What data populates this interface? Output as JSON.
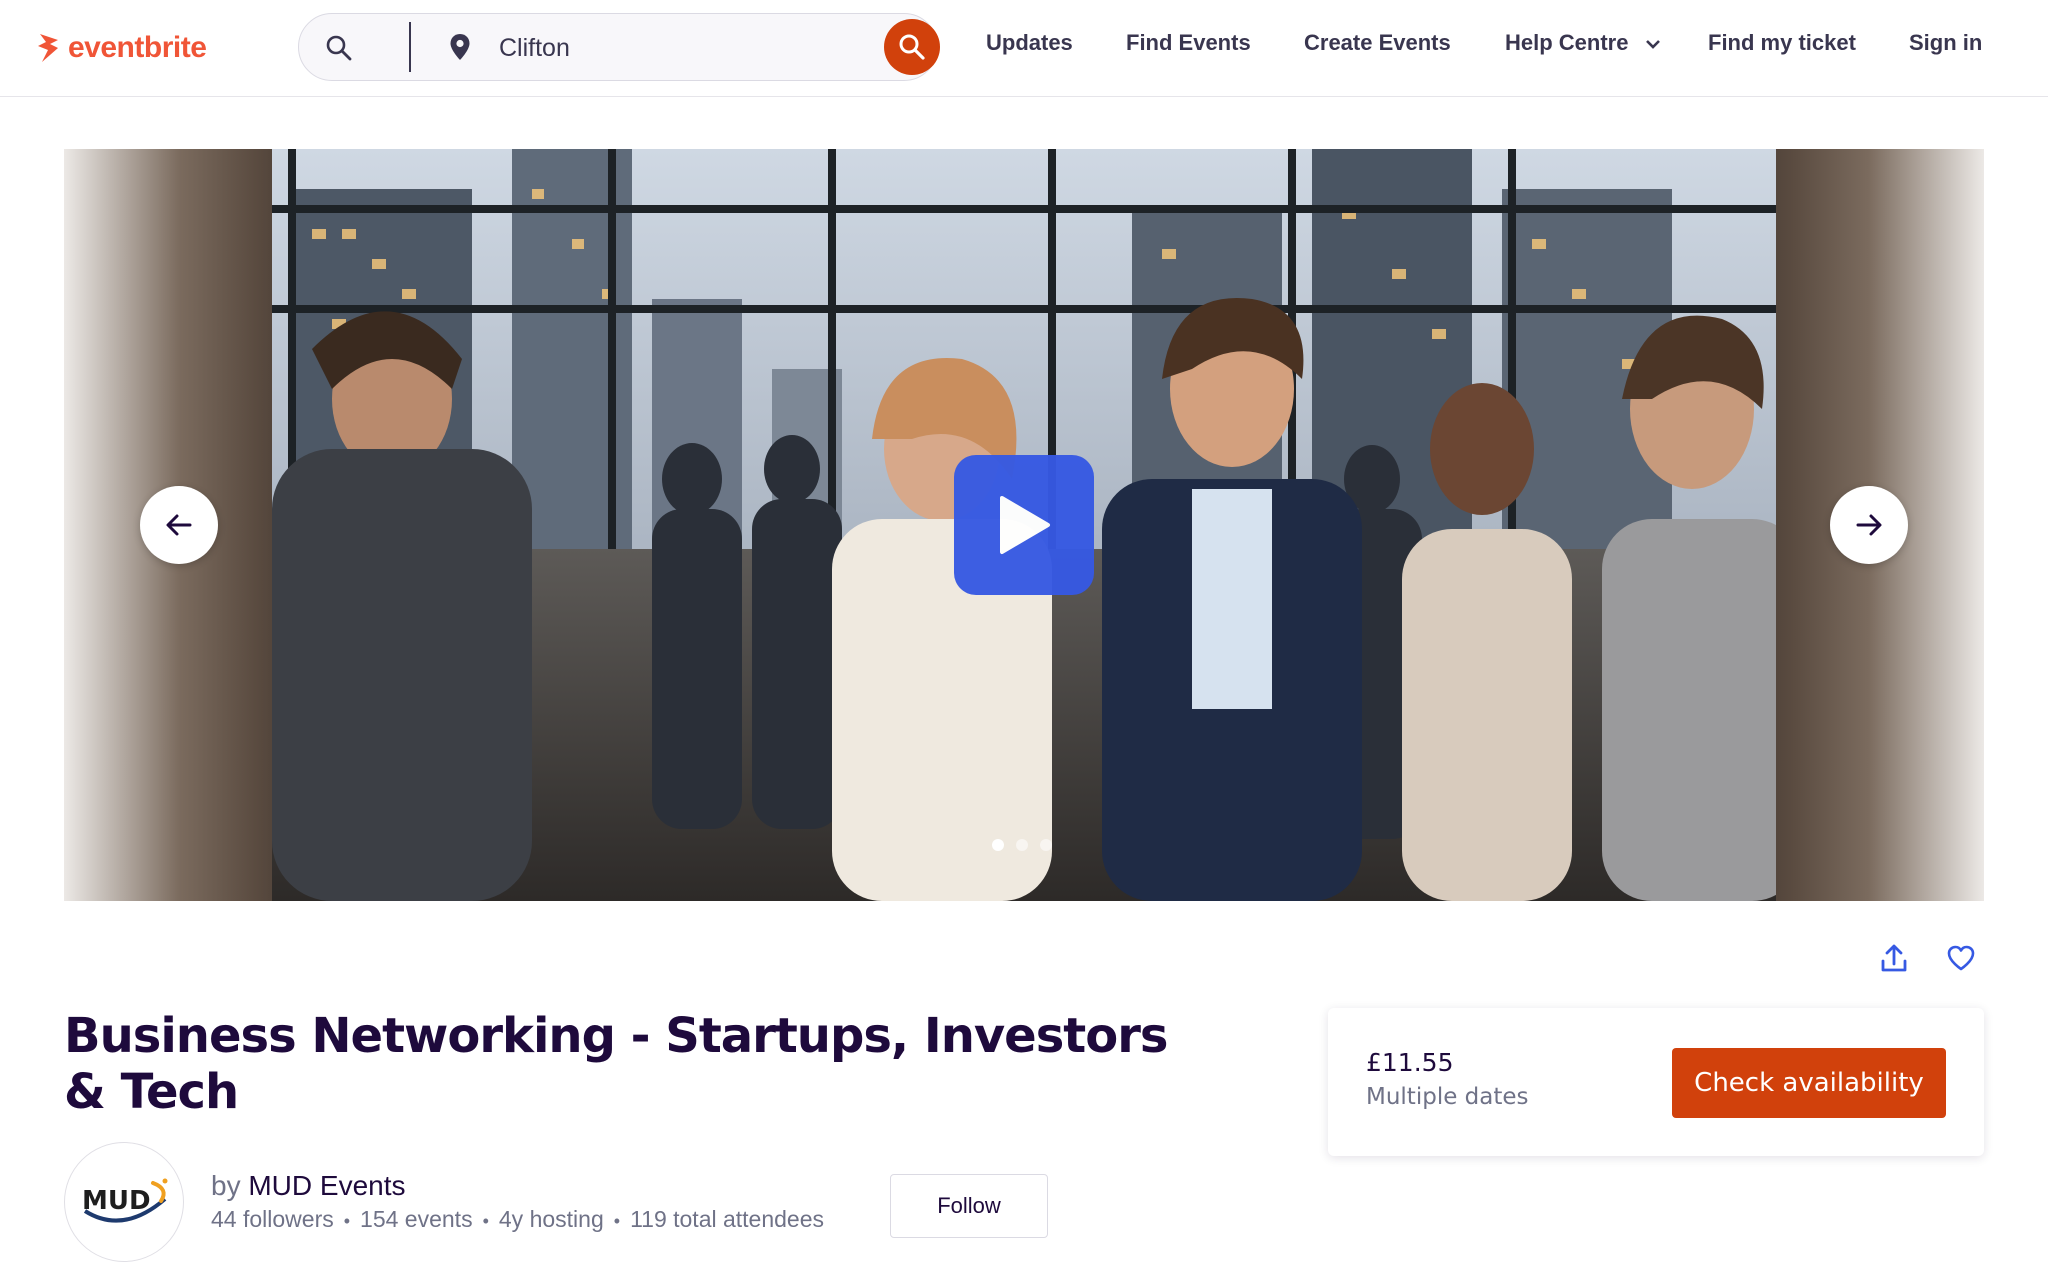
{
  "header": {
    "logo_text": "eventbrite",
    "search": {
      "location_value": "Clifton"
    },
    "nav": [
      {
        "label": "Updates"
      },
      {
        "label": "Find Events"
      },
      {
        "label": "Create Events"
      },
      {
        "label": "Help Centre"
      },
      {
        "label": "Find my ticket"
      },
      {
        "label": "Sign in"
      }
    ]
  },
  "hero": {
    "slide_count": 3,
    "active_slide": 1
  },
  "event": {
    "title": "Business Networking - Startups, Investors & Tech",
    "organizer": {
      "by_prefix": "by",
      "name": "MUD Events",
      "avatar_text": "MUD",
      "followers": "44 followers",
      "events": "154 events",
      "hosting": "4y hosting",
      "attendees": "119 total attendees",
      "follow_label": "Follow"
    },
    "ticket": {
      "price": "£11.55",
      "dates": "Multiple dates",
      "cta_label": "Check availability"
    }
  },
  "colors": {
    "brand": "#f05537",
    "cta": "#d1410c",
    "play": "#3659e3",
    "text_dark": "#1e0a3c",
    "text_muted": "#6f7287"
  }
}
